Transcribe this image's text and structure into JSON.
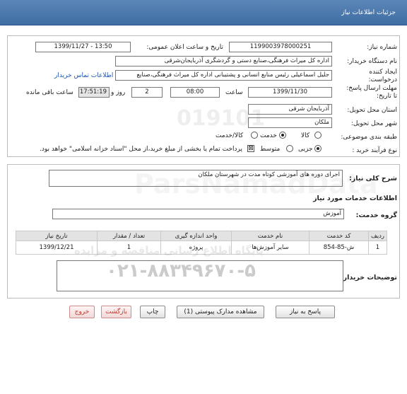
{
  "header": {
    "title": "جزئیات اطلاعات نیاز"
  },
  "form": {
    "need_number": {
      "label": "شماره نیاز:",
      "value": "1199003978000251"
    },
    "announce_datetime": {
      "label": "تاریخ و ساعت اعلان عمومی:",
      "value": "1399/11/27 - 13:50"
    },
    "buyer_org": {
      "label": "نام دستگاه خریدار:",
      "value": "اداره کل میراث فرهنگی،صنایع دستی و گردشگری آذربایجان‌شرقی"
    },
    "requester": {
      "label_line1": "ایجاد کننده",
      "label_line2": "درخواست:",
      "value": "جلیل اسماعیلی رئیس منابع انسانی و پشتیبانی اداره کل میراث فرهنگی،صنایع",
      "contact_link": "اطلاعات تماس خریدار"
    },
    "deadline": {
      "label_line1": "مهلت ارسال پاسخ:",
      "label_line2": "تا تاریخ:",
      "date": "1399/11/30",
      "time_label": "ساعت",
      "time": "08:00",
      "days": "2",
      "days_label": "روز و",
      "remaining": "17:51:19",
      "remaining_label": "ساعت باقی مانده"
    },
    "province": {
      "label": "استان محل تحویل:",
      "value": "آذربایجان شرقی"
    },
    "city": {
      "label": "شهر محل تحویل:",
      "value": "ملکان"
    },
    "category": {
      "label": "طبقه بندی موضوعی:",
      "options": [
        "کالا",
        "خدمت",
        "کالا/خدمت"
      ],
      "selected": "خدمت"
    },
    "process_type": {
      "label": "نوع فرآیند خرید :",
      "options": [
        "جزیی",
        "متوسط"
      ],
      "selected": "جزیی",
      "note": "پرداخت تمام یا بخشی از مبلغ خرید،از محل \"اسناد خزانه اسلامی\" خواهد بود."
    }
  },
  "summary": {
    "label": "شرح کلی نیاز:",
    "value": "اجرای دوره های آموزشی کوتاه مدت در شهرستان ملکان"
  },
  "services_info": {
    "title": "اطلاعات خدمات مورد نیاز",
    "group_label": "گروه خدمت:",
    "group_value": "آموزش",
    "columns": [
      "ردیف",
      "کد خدمت",
      "نام خدمت",
      "واحد اندازه گیری",
      "تعداد / مقدار",
      "تاریخ نیاز"
    ],
    "rows": [
      {
        "row": "1",
        "code": "ش-85-854",
        "name": "سایر آموزش‌ها",
        "unit": "پروژه",
        "qty": "1",
        "date": "1399/12/21"
      }
    ]
  },
  "buyer_notes": {
    "label": "توضیحات خریدار:",
    "value": ""
  },
  "buttons": {
    "reply": "پاسخ به نیاز",
    "attachments": "مشاهده مدارک پیوستی (1)",
    "print": "چاپ",
    "back": "بازگشت",
    "exit": "خروج"
  },
  "watermark": {
    "line1": "ParsNamadData",
    "line2": "پایگاه اطلاع رسانی مناقصه و مزایده",
    "phone": "۰۲۱-۸۸۳۴۹۶۷۰-۵",
    "code": "019101"
  }
}
